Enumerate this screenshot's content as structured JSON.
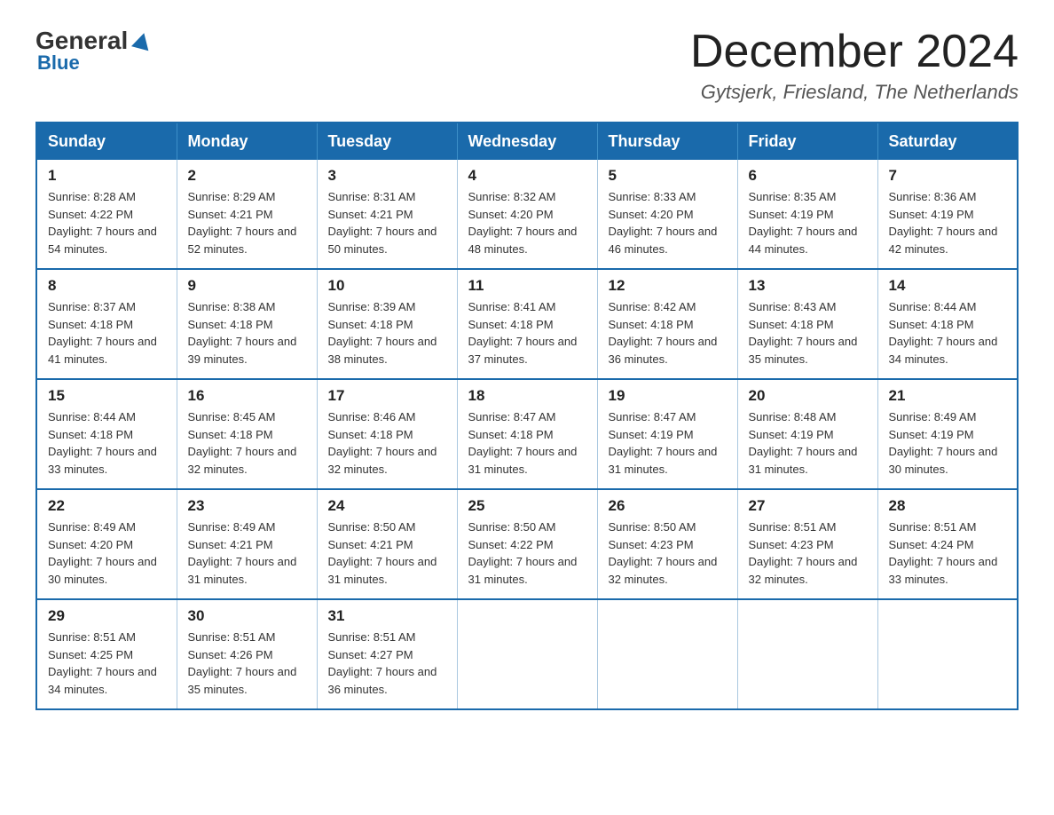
{
  "header": {
    "logo": {
      "general": "General",
      "blue": "Blue",
      "tagline": "Blue"
    },
    "title": "December 2024",
    "location": "Gytsjerk, Friesland, The Netherlands"
  },
  "weekdays": [
    "Sunday",
    "Monday",
    "Tuesday",
    "Wednesday",
    "Thursday",
    "Friday",
    "Saturday"
  ],
  "weeks": [
    [
      {
        "day": "1",
        "sunrise": "8:28 AM",
        "sunset": "4:22 PM",
        "daylight": "7 hours and 54 minutes."
      },
      {
        "day": "2",
        "sunrise": "8:29 AM",
        "sunset": "4:21 PM",
        "daylight": "7 hours and 52 minutes."
      },
      {
        "day": "3",
        "sunrise": "8:31 AM",
        "sunset": "4:21 PM",
        "daylight": "7 hours and 50 minutes."
      },
      {
        "day": "4",
        "sunrise": "8:32 AM",
        "sunset": "4:20 PM",
        "daylight": "7 hours and 48 minutes."
      },
      {
        "day": "5",
        "sunrise": "8:33 AM",
        "sunset": "4:20 PM",
        "daylight": "7 hours and 46 minutes."
      },
      {
        "day": "6",
        "sunrise": "8:35 AM",
        "sunset": "4:19 PM",
        "daylight": "7 hours and 44 minutes."
      },
      {
        "day": "7",
        "sunrise": "8:36 AM",
        "sunset": "4:19 PM",
        "daylight": "7 hours and 42 minutes."
      }
    ],
    [
      {
        "day": "8",
        "sunrise": "8:37 AM",
        "sunset": "4:18 PM",
        "daylight": "7 hours and 41 minutes."
      },
      {
        "day": "9",
        "sunrise": "8:38 AM",
        "sunset": "4:18 PM",
        "daylight": "7 hours and 39 minutes."
      },
      {
        "day": "10",
        "sunrise": "8:39 AM",
        "sunset": "4:18 PM",
        "daylight": "7 hours and 38 minutes."
      },
      {
        "day": "11",
        "sunrise": "8:41 AM",
        "sunset": "4:18 PM",
        "daylight": "7 hours and 37 minutes."
      },
      {
        "day": "12",
        "sunrise": "8:42 AM",
        "sunset": "4:18 PM",
        "daylight": "7 hours and 36 minutes."
      },
      {
        "day": "13",
        "sunrise": "8:43 AM",
        "sunset": "4:18 PM",
        "daylight": "7 hours and 35 minutes."
      },
      {
        "day": "14",
        "sunrise": "8:44 AM",
        "sunset": "4:18 PM",
        "daylight": "7 hours and 34 minutes."
      }
    ],
    [
      {
        "day": "15",
        "sunrise": "8:44 AM",
        "sunset": "4:18 PM",
        "daylight": "7 hours and 33 minutes."
      },
      {
        "day": "16",
        "sunrise": "8:45 AM",
        "sunset": "4:18 PM",
        "daylight": "7 hours and 32 minutes."
      },
      {
        "day": "17",
        "sunrise": "8:46 AM",
        "sunset": "4:18 PM",
        "daylight": "7 hours and 32 minutes."
      },
      {
        "day": "18",
        "sunrise": "8:47 AM",
        "sunset": "4:18 PM",
        "daylight": "7 hours and 31 minutes."
      },
      {
        "day": "19",
        "sunrise": "8:47 AM",
        "sunset": "4:19 PM",
        "daylight": "7 hours and 31 minutes."
      },
      {
        "day": "20",
        "sunrise": "8:48 AM",
        "sunset": "4:19 PM",
        "daylight": "7 hours and 31 minutes."
      },
      {
        "day": "21",
        "sunrise": "8:49 AM",
        "sunset": "4:19 PM",
        "daylight": "7 hours and 30 minutes."
      }
    ],
    [
      {
        "day": "22",
        "sunrise": "8:49 AM",
        "sunset": "4:20 PM",
        "daylight": "7 hours and 30 minutes."
      },
      {
        "day": "23",
        "sunrise": "8:49 AM",
        "sunset": "4:21 PM",
        "daylight": "7 hours and 31 minutes."
      },
      {
        "day": "24",
        "sunrise": "8:50 AM",
        "sunset": "4:21 PM",
        "daylight": "7 hours and 31 minutes."
      },
      {
        "day": "25",
        "sunrise": "8:50 AM",
        "sunset": "4:22 PM",
        "daylight": "7 hours and 31 minutes."
      },
      {
        "day": "26",
        "sunrise": "8:50 AM",
        "sunset": "4:23 PM",
        "daylight": "7 hours and 32 minutes."
      },
      {
        "day": "27",
        "sunrise": "8:51 AM",
        "sunset": "4:23 PM",
        "daylight": "7 hours and 32 minutes."
      },
      {
        "day": "28",
        "sunrise": "8:51 AM",
        "sunset": "4:24 PM",
        "daylight": "7 hours and 33 minutes."
      }
    ],
    [
      {
        "day": "29",
        "sunrise": "8:51 AM",
        "sunset": "4:25 PM",
        "daylight": "7 hours and 34 minutes."
      },
      {
        "day": "30",
        "sunrise": "8:51 AM",
        "sunset": "4:26 PM",
        "daylight": "7 hours and 35 minutes."
      },
      {
        "day": "31",
        "sunrise": "8:51 AM",
        "sunset": "4:27 PM",
        "daylight": "7 hours and 36 minutes."
      },
      null,
      null,
      null,
      null
    ]
  ]
}
